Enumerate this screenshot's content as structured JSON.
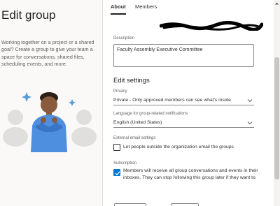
{
  "sidebar": {
    "title": "Edit group",
    "intro": "Working together on a project or a shared goal? Create a group to give your team a space for conversations, shared files, scheduling events, and more."
  },
  "tabs": [
    {
      "label": "About",
      "active": true
    },
    {
      "label": "Members",
      "active": false
    }
  ],
  "form": {
    "description": {
      "label": "Description",
      "value": "Faculty Assembly Executive Committee"
    },
    "edit_settings_title": "Edit settings",
    "privacy": {
      "label": "Privacy",
      "value": "Private - Only approved members can see what's inside"
    },
    "language": {
      "label": "Language for group-related notifications",
      "value": "English (United States)"
    },
    "external_email": {
      "label": "External email settings",
      "checkbox_label": "Let people outside the organization email the groups",
      "checked": false
    },
    "subscription": {
      "label": "Subscription",
      "checkbox_label": "Members will receive all group conversations and events in their inboxes. They can stop following this group later if they want to.",
      "checked": true
    }
  },
  "colors": {
    "accent": "#0078d4",
    "panel_bg": "#faf9f8",
    "avatar_shirt": "#4f8fe0",
    "avatar_skin": "#8a5a3c"
  },
  "icons": [
    "chevron-down-icon",
    "checkmark-icon",
    "sparkle-icon",
    "person-avatar-icon"
  ]
}
